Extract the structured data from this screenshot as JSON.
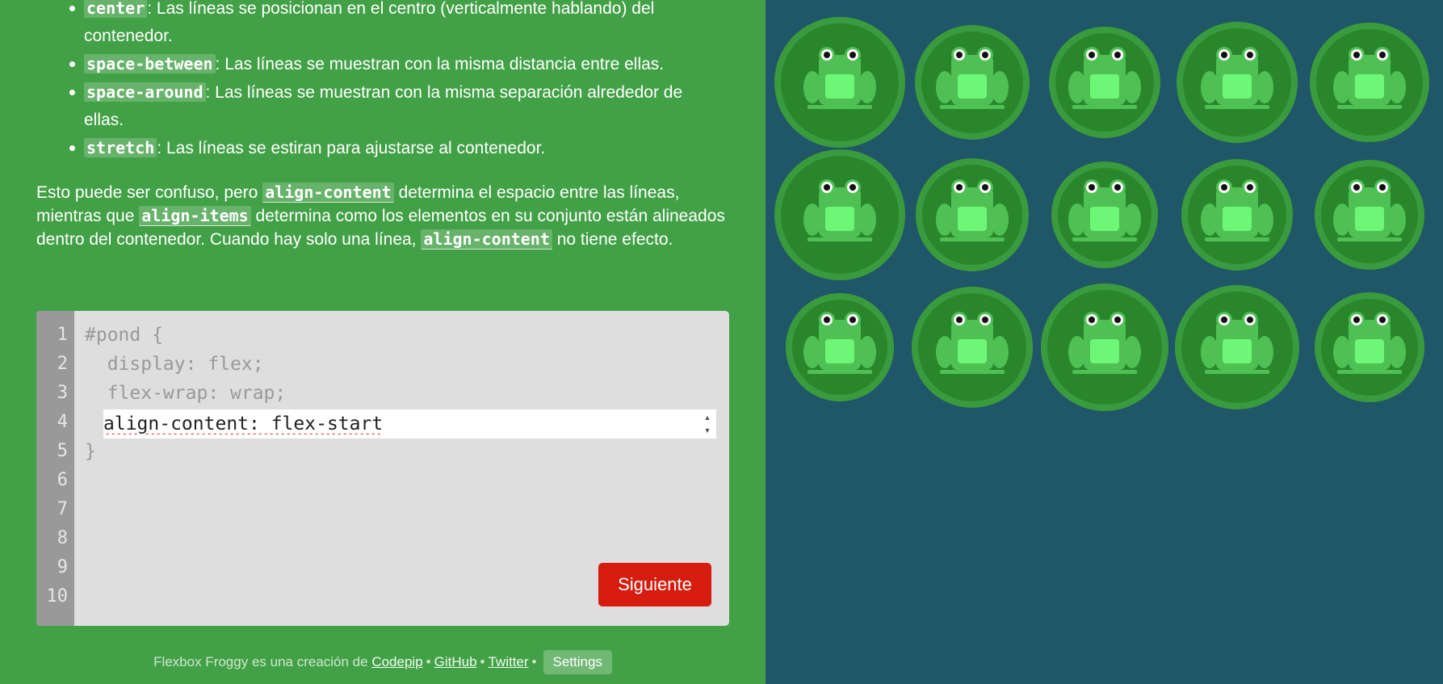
{
  "instructions": {
    "items": [
      {
        "code": "center",
        "text": ": Las líneas se posicionan en el centro (verticalmente hablando) del"
      },
      {
        "code": "",
        "text": "contenedor."
      },
      {
        "code": "space-between",
        "text": ": Las líneas se muestran con la misma distancia entre ellas."
      },
      {
        "code": "space-around",
        "text": ": Las líneas se muestran con la misma separación alrededor de"
      },
      {
        "code": "",
        "text": "ellas."
      },
      {
        "code": "stretch",
        "text": ": Las líneas se estiran para ajustarse al contenedor."
      }
    ],
    "para": {
      "t1": "Esto puede ser confuso, pero ",
      "c1": "align-content",
      "t2": " determina el espacio entre las líneas, mientras que ",
      "c2": "align-items",
      "t3": " determina como los elementos en su conjunto están alineados dentro del contenedor. Cuando hay solo una línea, ",
      "c3": "align-content",
      "t4": " no tiene efecto."
    }
  },
  "editor": {
    "line_numbers": [
      "1",
      "2",
      "3",
      "4",
      "5",
      "6",
      "7",
      "8",
      "9",
      "10"
    ],
    "lines": [
      "#pond {",
      "  display: flex;",
      "  flex-wrap: wrap;",
      "",
      "}"
    ],
    "input_value": "align-content: flex-start",
    "next_label": "Siguiente"
  },
  "footer": {
    "prefix": "Flexbox Froggy es una creación de ",
    "links": [
      "Codepip",
      "GitHub",
      "Twitter"
    ],
    "separator": "•",
    "settings_label": "Settings"
  },
  "pond": {
    "frog_count": 15,
    "colors": {
      "water": "#1f5768",
      "pad": "#29862c",
      "frog": "#4fc154",
      "belly": "#6ef776"
    }
  }
}
